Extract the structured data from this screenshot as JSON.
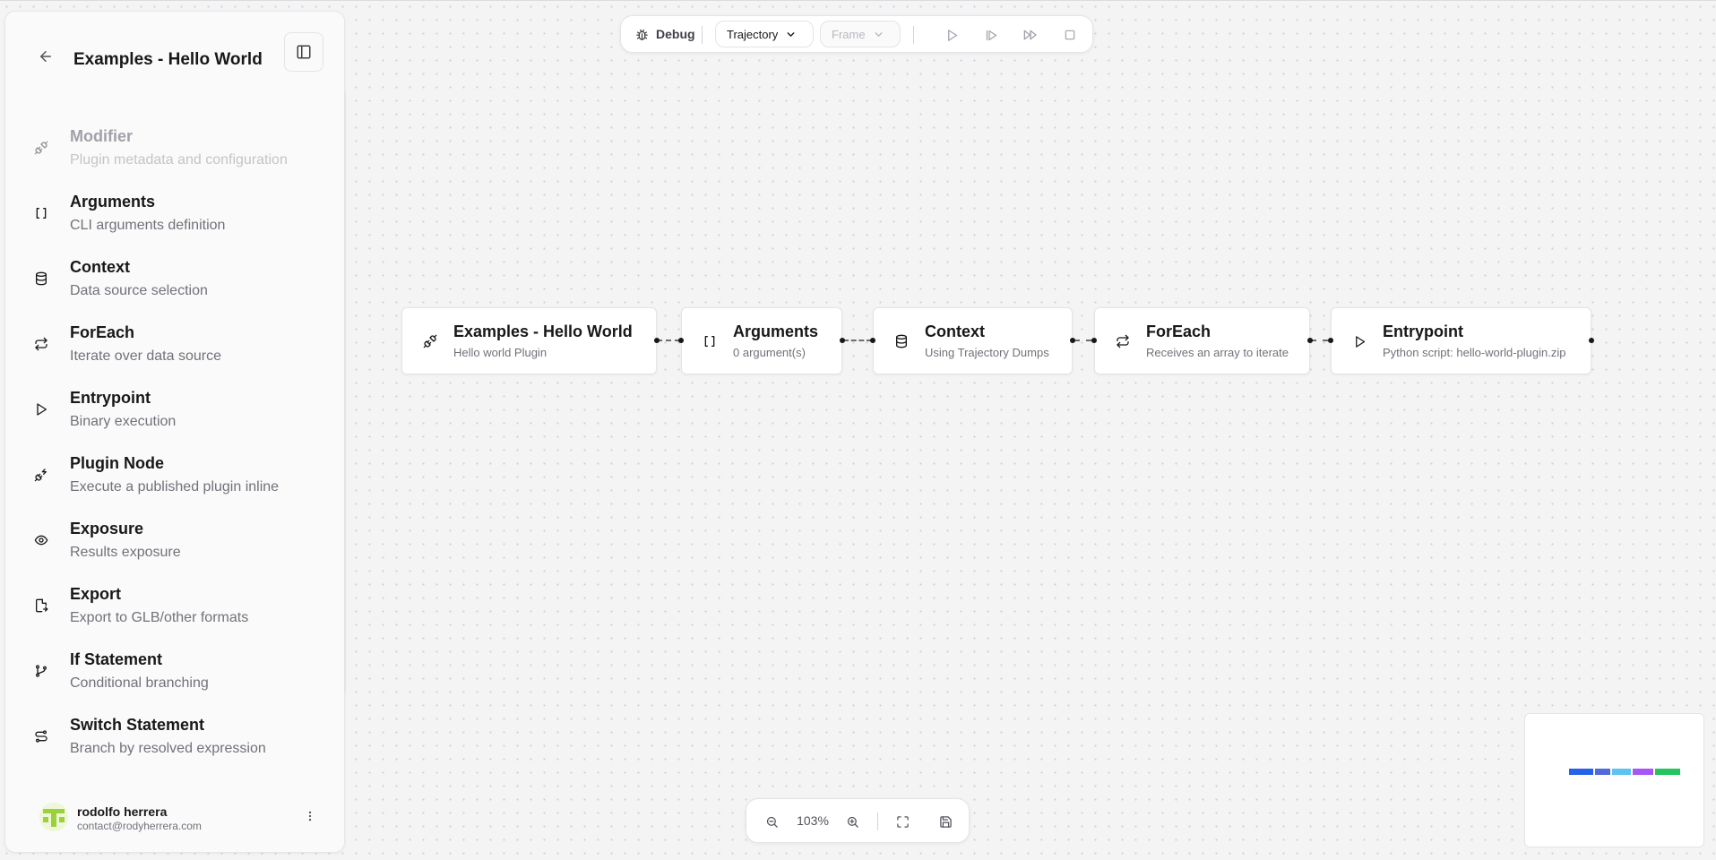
{
  "sidebar": {
    "title": "Examples - Hello World",
    "back_icon": "arrow-left-icon",
    "toggle_icon": "panel-left-icon",
    "items": [
      {
        "label": "Modifier",
        "description": "Plugin metadata and configuration",
        "icon": "plug-icon",
        "disabled": true
      },
      {
        "label": "Arguments",
        "description": "CLI arguments definition",
        "icon": "brackets-icon"
      },
      {
        "label": "Context",
        "description": "Data source selection",
        "icon": "database-icon"
      },
      {
        "label": "ForEach",
        "description": "Iterate over data source",
        "icon": "repeat-icon"
      },
      {
        "label": "Entrypoint",
        "description": "Binary execution",
        "icon": "play-icon"
      },
      {
        "label": "Plugin Node",
        "description": "Execute a published plugin inline",
        "icon": "plug-zap-icon"
      },
      {
        "label": "Exposure",
        "description": "Results exposure",
        "icon": "eye-icon"
      },
      {
        "label": "Export",
        "description": "Export to GLB/other formats",
        "icon": "file-export-icon"
      },
      {
        "label": "If Statement",
        "description": "Conditional branching",
        "icon": "git-branch-icon"
      },
      {
        "label": "Switch Statement",
        "description": "Branch by resolved expression",
        "icon": "route-icon"
      }
    ],
    "user": {
      "name": "rodolfo herrera",
      "email": "contact@rodyherrera.com"
    }
  },
  "toolbar": {
    "debug_label": "Debug",
    "trajectory_label": "Trajectory",
    "frame_label": "Frame",
    "buttons": [
      "play-icon",
      "step-forward-icon",
      "fast-forward-icon",
      "stop-icon"
    ]
  },
  "nodes": [
    {
      "title": "Examples - Hello World",
      "subtitle": "Hello world Plugin",
      "icon": "plug-icon"
    },
    {
      "title": "Arguments",
      "subtitle": "0 argument(s)",
      "icon": "brackets-icon"
    },
    {
      "title": "Context",
      "subtitle": "Using Trajectory Dumps",
      "icon": "database-icon"
    },
    {
      "title": "ForEach",
      "subtitle": "Receives an array to iterate",
      "icon": "repeat-icon"
    },
    {
      "title": "Entrypoint",
      "subtitle": "Python script: hello-world-plugin.zip",
      "icon": "play-icon"
    }
  ],
  "minimap": {
    "colors": [
      "#2563eb",
      "#4f6bdc",
      "#5ec3f0",
      "#a855f7",
      "#22c55e"
    ]
  },
  "zoom": {
    "value": "103%"
  }
}
